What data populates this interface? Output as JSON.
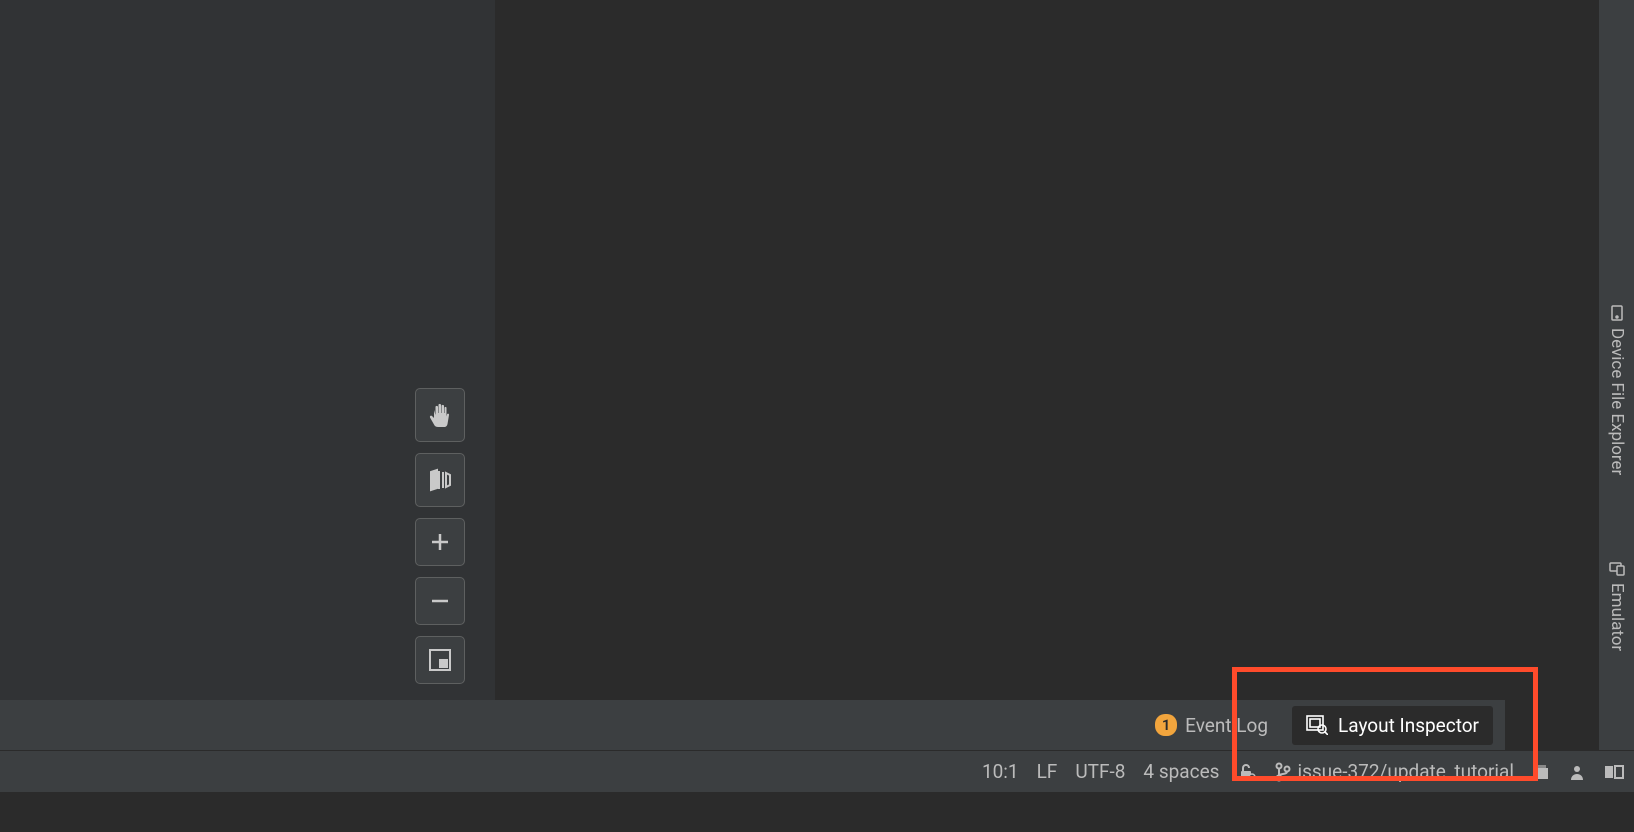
{
  "bottom_toolbar": {
    "event_log_badge": "1",
    "event_log_label": "Event Log",
    "layout_inspector_label": "Layout Inspector"
  },
  "status_bar": {
    "cursor_pos": "10:1",
    "line_ending": "LF",
    "encoding": "UTF-8",
    "indent": "4 spaces",
    "branch": "issue-372/update_tutorial"
  },
  "right_sidebar": {
    "device_file_explorer": "Device File Explorer",
    "emulator": "Emulator"
  }
}
